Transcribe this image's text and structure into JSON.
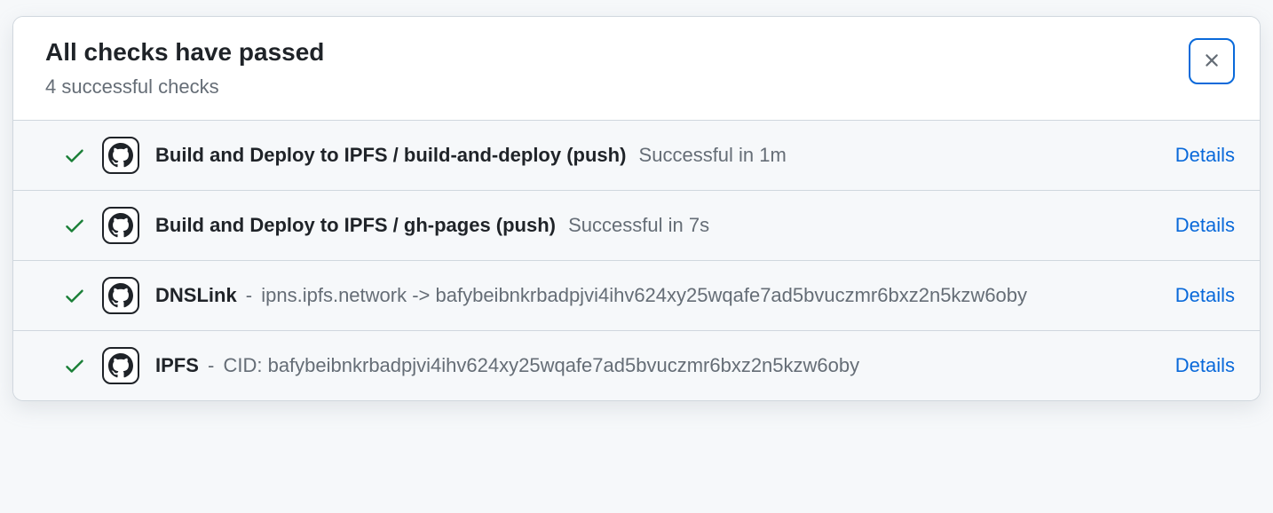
{
  "header": {
    "title": "All checks have passed",
    "subtitle": "4 successful checks"
  },
  "details_label": "Details",
  "checks": [
    {
      "name": "Build and Deploy to IPFS / build-and-deploy (push)",
      "description": "Successful in 1m",
      "separator": " "
    },
    {
      "name": "Build and Deploy to IPFS / gh-pages (push)",
      "description": "Successful in 7s",
      "separator": " "
    },
    {
      "name": "DNSLink",
      "description": "ipns.ipfs.network -> bafybeibnkrbadpjvi4ihv624xy25wqafe7ad5bvuczmr6bxz2n5kzw6oby",
      "separator": " - "
    },
    {
      "name": "IPFS",
      "description": "CID: bafybeibnkrbadpjvi4ihv624xy25wqafe7ad5bvuczmr6bxz2n5kzw6oby",
      "separator": " - "
    }
  ]
}
